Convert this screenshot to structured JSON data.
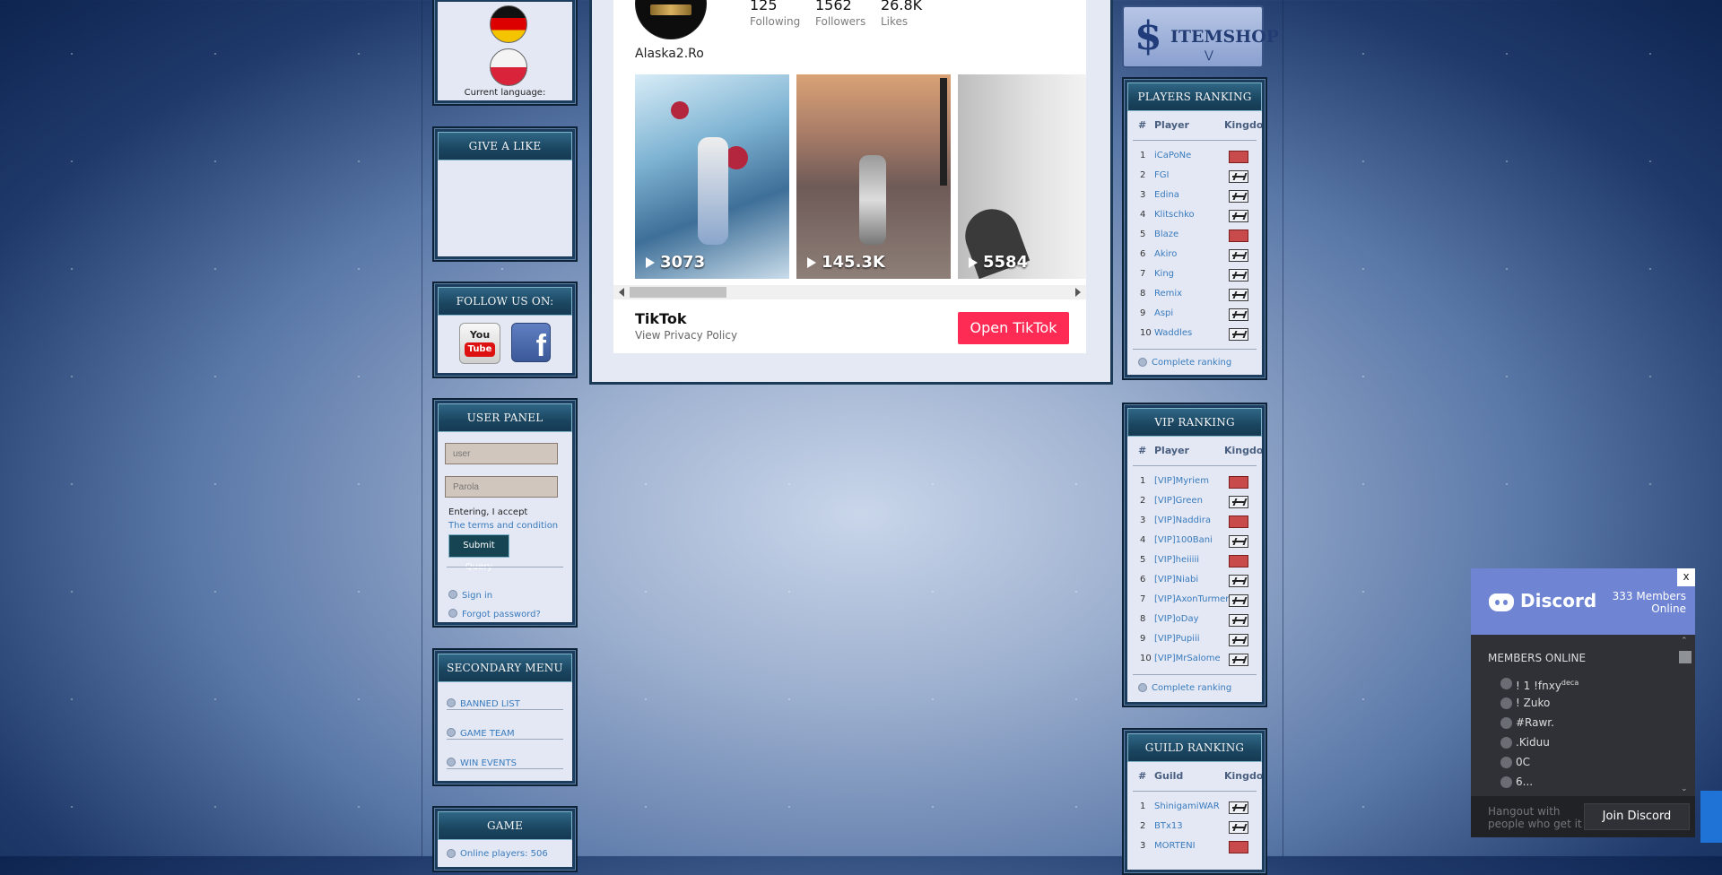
{
  "left": {
    "language": {
      "current_label": "Current language:",
      "flags": [
        "germany-flag",
        "poland-flag"
      ]
    },
    "give_like": {
      "title": "GIVE A LIKE"
    },
    "follow": {
      "title": "FOLLOW US ON:"
    },
    "user_panel": {
      "title": "USER PANEL",
      "user_placeholder": "user",
      "pass_placeholder": "Parola",
      "accept_text": "Entering, I accept",
      "terms_link": "The terms and condition",
      "submit": "Submit Query",
      "sign_in": "Sign in",
      "forgot": "Forgot password?"
    },
    "secondary": {
      "title": "SECONDARY MENU",
      "items": [
        "BANNED LIST",
        "GAME TEAM",
        "WIN EVENTS"
      ]
    },
    "game_info": {
      "title": "GAME INFORMATIONS",
      "online_label": "Online players:",
      "online_value": "506"
    }
  },
  "tiktok": {
    "following": "125",
    "following_label": "Following",
    "followers": "1562",
    "followers_label": "Followers",
    "likes": "26.8K",
    "likes_label": "Likes",
    "username": "Alaska2.Ro",
    "videos": [
      "3073",
      "145.3K",
      "5584"
    ],
    "brand": "TikTok",
    "privacy": "View Privacy Policy",
    "open": "Open TikTok"
  },
  "right": {
    "itemshop": {
      "label": "ITEMSHOP"
    },
    "players": {
      "title": "PLAYERS RANKING",
      "col_rank": "#",
      "col_player": "Player",
      "col_kingdom": "Kingdom",
      "rows": [
        {
          "rank": "1",
          "name": "iCaPoNe",
          "kingdom": "red"
        },
        {
          "rank": "2",
          "name": "FGI",
          "kingdom": "white"
        },
        {
          "rank": "3",
          "name": "Edina",
          "kingdom": "white"
        },
        {
          "rank": "4",
          "name": "Klitschko",
          "kingdom": "white"
        },
        {
          "rank": "5",
          "name": "Blaze",
          "kingdom": "red"
        },
        {
          "rank": "6",
          "name": "Akiro",
          "kingdom": "white"
        },
        {
          "rank": "7",
          "name": "King",
          "kingdom": "white"
        },
        {
          "rank": "8",
          "name": "Remix",
          "kingdom": "white"
        },
        {
          "rank": "9",
          "name": "Aspi",
          "kingdom": "white"
        },
        {
          "rank": "10",
          "name": "Waddles",
          "kingdom": "white"
        }
      ],
      "more": "Complete ranking"
    },
    "vip": {
      "title": "VIP RANKING",
      "col_rank": "#",
      "col_player": "Player",
      "col_kingdom": "Kingdom",
      "rows": [
        {
          "rank": "1",
          "name": "[VIP]Myriem",
          "kingdom": "red"
        },
        {
          "rank": "2",
          "name": "[VIP]Green",
          "kingdom": "white"
        },
        {
          "rank": "3",
          "name": "[VIP]Naddira",
          "kingdom": "red"
        },
        {
          "rank": "4",
          "name": "[VIP]100Bani",
          "kingdom": "white"
        },
        {
          "rank": "5",
          "name": "[VIP]heiiiii",
          "kingdom": "red"
        },
        {
          "rank": "6",
          "name": "[VIP]Niabi",
          "kingdom": "white"
        },
        {
          "rank": "7",
          "name": "[VIP]AxonTurmentu",
          "kingdom": "white"
        },
        {
          "rank": "8",
          "name": "[VIP]oDay",
          "kingdom": "white"
        },
        {
          "rank": "9",
          "name": "[VIP]Pupiii",
          "kingdom": "white"
        },
        {
          "rank": "10",
          "name": "[VIP]MrSalome",
          "kingdom": "white"
        }
      ],
      "more": "Complete ranking"
    },
    "guild": {
      "title": "GUILD RANKING",
      "col_rank": "#",
      "col_guild": "Guild",
      "col_kingdom": "Kingdom",
      "rows": [
        {
          "rank": "1",
          "name": "ShinigamiWAR",
          "kingdom": "white"
        },
        {
          "rank": "2",
          "name": "BTx13",
          "kingdom": "white"
        },
        {
          "rank": "3",
          "name": "MORTENI",
          "kingdom": "red"
        }
      ]
    }
  },
  "discord": {
    "brand": "Discord",
    "members_online": "333 Members Online",
    "close": "x",
    "section": "MEMBERS ONLINE",
    "members": [
      "! 1 !fnxy",
      "! Zuko",
      "#Rawr.",
      ".Kiduu",
      "0C",
      "6..."
    ],
    "member_sup": "deca",
    "hangout": "Hangout with people who get it",
    "join": "Join Discord"
  }
}
